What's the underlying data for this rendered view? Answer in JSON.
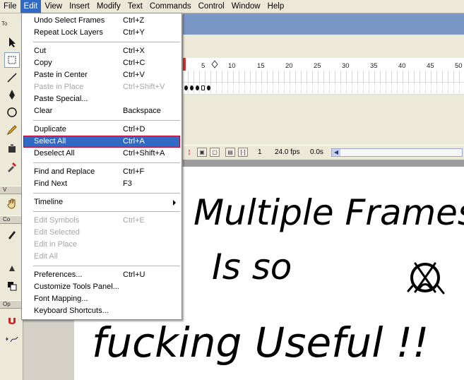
{
  "menubar": [
    "File",
    "Edit",
    "View",
    "Insert",
    "Modify",
    "Text",
    "Commands",
    "Control",
    "Window",
    "Help"
  ],
  "tools_panel": {
    "header": "To",
    "view_label": "V",
    "colors_label": "Co",
    "options_label": "Op"
  },
  "timeline": {
    "ruler_labels": [
      "5",
      "10",
      "15",
      "20",
      "25",
      "30",
      "35",
      "40",
      "45",
      "50"
    ],
    "status": {
      "current_frame": "1",
      "frame_rate": "24.0 fps",
      "elapsed_time": "0.0s"
    }
  },
  "edit_menu": {
    "items": [
      {
        "label": "Undo Select Frames",
        "shortcut": "Ctrl+Z",
        "disabled": false
      },
      {
        "label": "Repeat Lock Layers",
        "shortcut": "Ctrl+Y",
        "disabled": false
      },
      {
        "label": "Cut",
        "shortcut": "Ctrl+X",
        "disabled": false
      },
      {
        "label": "Copy",
        "shortcut": "Ctrl+C",
        "disabled": false
      },
      {
        "label": "Paste in Center",
        "shortcut": "Ctrl+V",
        "disabled": false
      },
      {
        "label": "Paste in Place",
        "shortcut": "Ctrl+Shift+V",
        "disabled": true
      },
      {
        "label": "Paste Special...",
        "shortcut": "",
        "disabled": false
      },
      {
        "label": "Clear",
        "shortcut": "Backspace",
        "disabled": false
      },
      {
        "label": "Duplicate",
        "shortcut": "Ctrl+D",
        "disabled": false
      },
      {
        "label": "Select All",
        "shortcut": "Ctrl+A",
        "disabled": false,
        "highlighted": true
      },
      {
        "label": "Deselect All",
        "shortcut": "Ctrl+Shift+A",
        "disabled": false
      },
      {
        "label": "Find and Replace",
        "shortcut": "Ctrl+F",
        "disabled": false
      },
      {
        "label": "Find Next",
        "shortcut": "F3",
        "disabled": false
      },
      {
        "label": "Timeline",
        "shortcut": "",
        "disabled": false,
        "submenu": true
      },
      {
        "label": "Edit Symbols",
        "shortcut": "Ctrl+E",
        "disabled": true
      },
      {
        "label": "Edit Selected",
        "shortcut": "",
        "disabled": true
      },
      {
        "label": "Edit in Place",
        "shortcut": "",
        "disabled": true
      },
      {
        "label": "Edit All",
        "shortcut": "",
        "disabled": true
      },
      {
        "label": "Preferences...",
        "shortcut": "Ctrl+U",
        "disabled": false
      },
      {
        "label": "Customize Tools Panel...",
        "shortcut": "",
        "disabled": false
      },
      {
        "label": "Font Mapping...",
        "shortcut": "",
        "disabled": false
      },
      {
        "label": "Keyboard Shortcuts...",
        "shortcut": "",
        "disabled": false
      }
    ]
  },
  "stage_text": {
    "line1": "Multiple Frames",
    "line2": "Is so",
    "line3": "fucking Useful !!"
  },
  "colors": {
    "menu_highlight": "#316ac5",
    "highlight_border": "#c4002d",
    "timeline_title": "#7b97c6"
  }
}
